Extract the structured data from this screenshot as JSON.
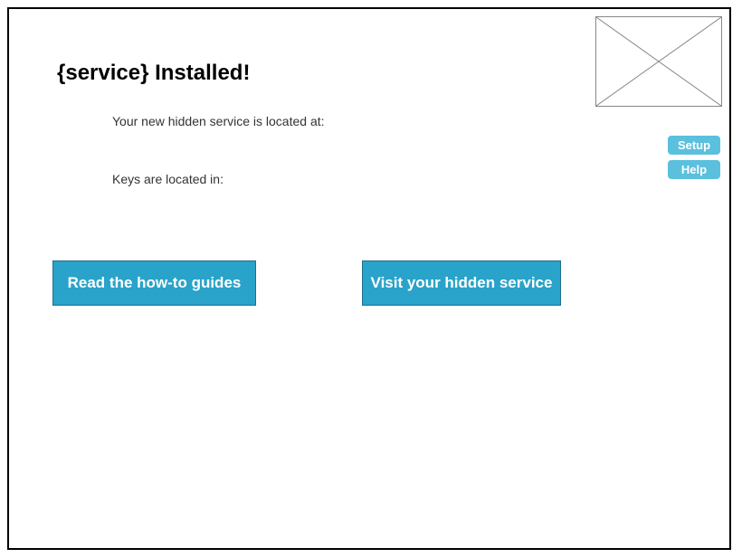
{
  "page": {
    "title": "{service} Installed!",
    "location_label": "Your new hidden service is located at:",
    "keys_label": "Keys are located in:"
  },
  "logo": {
    "icon": "image-placeholder-icon"
  },
  "side_nav": {
    "setup_label": "Setup",
    "help_label": "Help"
  },
  "actions": {
    "guides_label": "Read the how-to guides",
    "visit_label": "Visit your hidden service"
  },
  "colors": {
    "primary_button": "#29a3c9",
    "side_button": "#5bc0de",
    "frame_border": "#000000"
  }
}
